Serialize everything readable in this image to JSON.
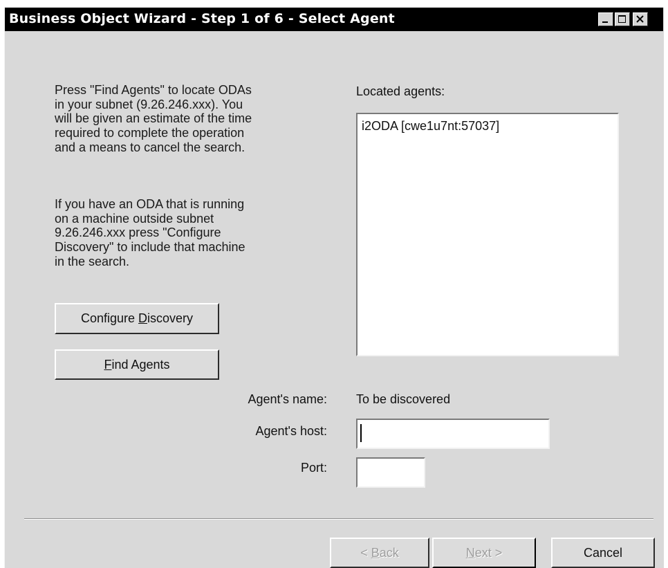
{
  "window": {
    "title": "Business Object Wizard - Step 1 of 6 - Select Agent"
  },
  "icons": {
    "minimize": "minimize-icon",
    "maximize": "maximize-icon",
    "close": "close-icon"
  },
  "instructions": {
    "paragraph1": "Press \"Find Agents\" to locate ODAs\nin your subnet (9.26.246.xxx). You\nwill be given an estimate of the time\nrequired to complete the operation\nand a means to cancel the search.",
    "paragraph2": "If you have an ODA that is running\non a machine outside subnet\n9.26.246.xxx press \"Configure\nDiscovery\" to include that machine\nin the search."
  },
  "buttons": {
    "configure_discovery": {
      "pre": "Configure ",
      "mnemonic": "D",
      "post": "iscovery"
    },
    "find_agents": {
      "pre": "",
      "mnemonic": "F",
      "post": "ind Agents"
    },
    "back": {
      "pre": "< ",
      "mnemonic": "B",
      "post": "ack"
    },
    "next": {
      "pre": "",
      "mnemonic": "N",
      "post": "ext >"
    },
    "cancel": {
      "label": "Cancel"
    }
  },
  "agents": {
    "heading": "Located agents:",
    "items": [
      "i2ODA [cwe1u7nt:57037]"
    ]
  },
  "form": {
    "name_label": "Agent's name:",
    "name_value": "To be discovered",
    "host_label": "Agent's host:",
    "host_value": "",
    "port_label": "Port:",
    "port_value": ""
  }
}
